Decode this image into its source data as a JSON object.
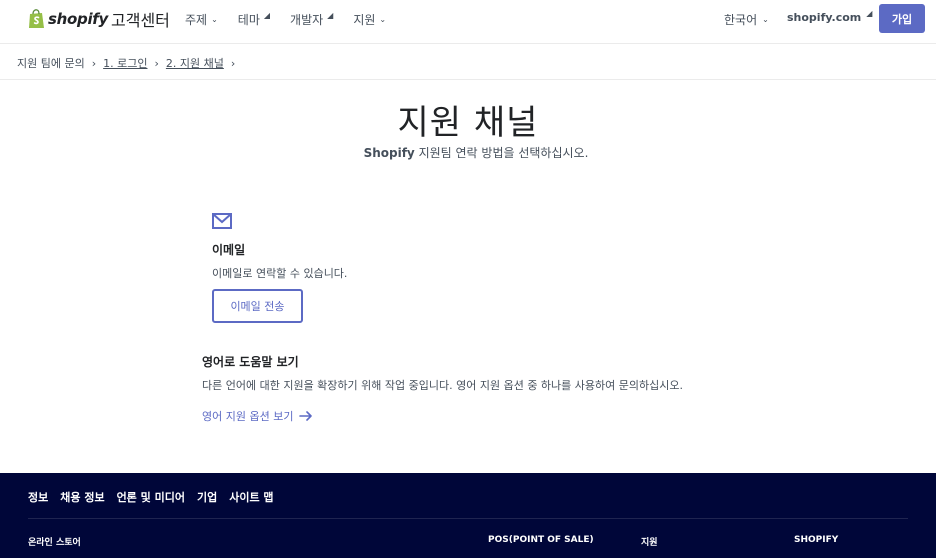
{
  "header": {
    "logo_word": "shopify",
    "logo_sub": "고객센터",
    "nav": [
      {
        "label": "주제",
        "kind": "dropdown"
      },
      {
        "label": "테마",
        "kind": "external"
      },
      {
        "label": "개발자",
        "kind": "external"
      },
      {
        "label": "지원",
        "kind": "dropdown"
      }
    ],
    "language": "한국어",
    "shop_link": "shopify.com",
    "signup": "가입"
  },
  "breadcrumb": {
    "root": "지원 팀에 문의",
    "step1": "1. 로그인",
    "step2": "2. 지원 채널"
  },
  "main": {
    "title": "지원 채널",
    "subtitle_brand": "Shopify",
    "subtitle_rest": " 지원팀 연락 방법을 선택하십시오.",
    "email": {
      "title": "이메일",
      "description": "이메일로 연락할 수 있습니다.",
      "button": "이메일 전송"
    },
    "english": {
      "title": "영어로 도움말 보기",
      "description": "다른 언어에 대한 지원을 확장하기 위해 작업 중입니다. 영어 지원 옵션 중 하나를 사용하여 문의하십시오.",
      "link": "영어 지원 옵션 보기"
    }
  },
  "footer": {
    "links": [
      "정보",
      "채용 정보",
      "언론 및 미디어",
      "기업",
      "사이트 맵"
    ],
    "columns": [
      "온라인 스토어",
      "POS(POINT OF SALE)",
      "지원",
      "SHOPIFY"
    ]
  },
  "colors": {
    "accent": "#5c6ac4",
    "footer_bg": "#000639",
    "text": "#212326",
    "muted": "#454f5b"
  }
}
